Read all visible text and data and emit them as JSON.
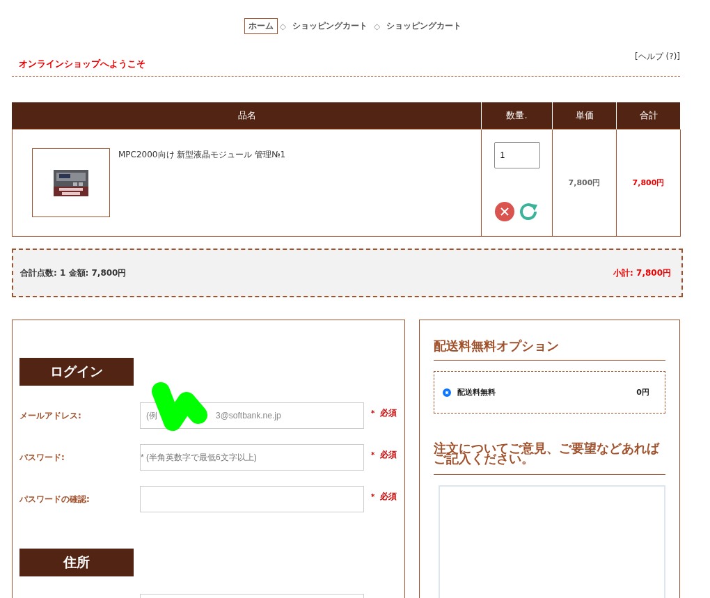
{
  "breadcrumb": [
    {
      "label": "ホーム",
      "selected": true
    },
    {
      "label": "ショッピングカート",
      "selected": false
    },
    {
      "label": "ショッピングカート",
      "selected": false
    }
  ],
  "breadcrumb_separator": "◇",
  "welcome": "オンラインショップへようこそ",
  "help_link": "[ヘルプ (?)]",
  "cart": {
    "columns": [
      "品名",
      "数量.",
      "単価",
      "合計"
    ],
    "rows": [
      {
        "name": "MPC2000向け 新型液晶モジュール 管理№1",
        "quantity": "1",
        "unit_price": "7,800円",
        "total": "7,800円"
      }
    ]
  },
  "summary": {
    "count_label": "合計点数: 1  金額: 7,800円",
    "subtotal": "小計: 7,800円"
  },
  "login": {
    "title": "ログイン",
    "fields": [
      {
        "label": "メールアドレス:",
        "placeholder_start": "(例",
        "placeholder_end": "3@softbank.ne.jp",
        "redacted": true,
        "required_mark": "*",
        "required": "必須"
      },
      {
        "label": "パスワード:",
        "placeholder": "* (半角英数字で最低6文字以上)",
        "redacted": false,
        "required_mark": "*",
        "required": "必須"
      },
      {
        "label": "パスワードの確認:",
        "redacted": false,
        "required_mark": "*",
        "required": "必須"
      }
    ]
  },
  "address": {
    "title": "住所"
  },
  "shipping": {
    "title": "配送料無料オプション",
    "options": [
      {
        "label": "配送料無料",
        "price": "0円",
        "selected": true
      }
    ]
  },
  "comments": {
    "title": "注文についてご意見、ご要望などあればご記入ください。"
  }
}
